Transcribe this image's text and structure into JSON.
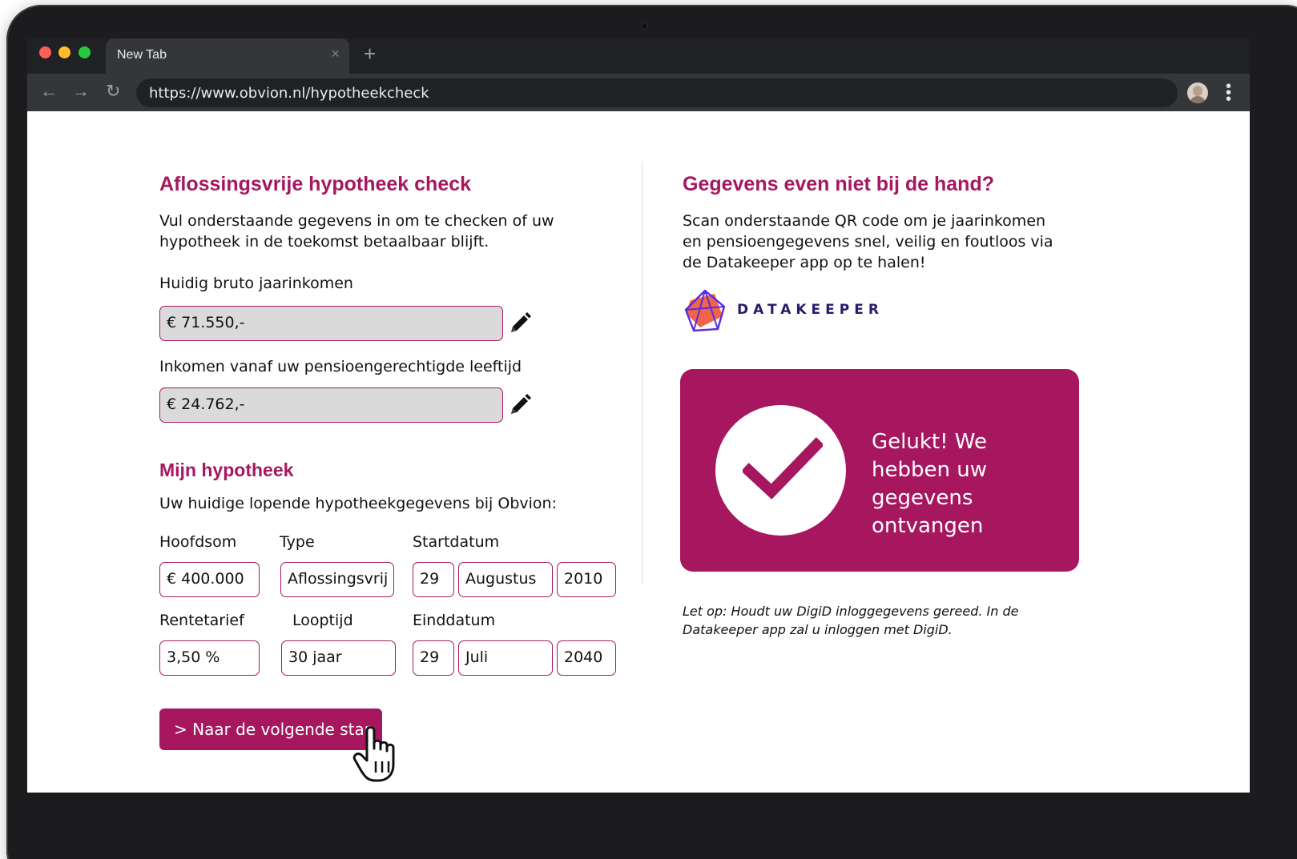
{
  "browser": {
    "tab_title": "New Tab",
    "tab_close": "×",
    "new_tab": "+",
    "url": "https://www.obvion.nl/hypotheekcheck",
    "back": "←",
    "forward": "→",
    "reload": "↻"
  },
  "left": {
    "title": "Aflossingsvrije hypotheek check",
    "intro": "Vul onderstaande gegevens in om te checken of uw hypotheek in de toekomst betaalbaar blijft.",
    "income_label": "Huidig bruto jaarinkomen",
    "income_value": "€  71.550,-",
    "pension_label": "Inkomen vanaf uw pensioengerechtigde leeftijd",
    "pension_value": "€  24.762,-",
    "mortgage_title": "Mijn hypotheek",
    "mortgage_intro": "Uw huidige lopende hypotheekgegevens bij Obvion:",
    "hoofdsom_label": "Hoofdsom",
    "hoofdsom_value": "€  400.000",
    "type_label": "Type",
    "type_value": "Aflossingsvrij",
    "startdatum_label": "Startdatum",
    "start_day": "29",
    "start_month": "Augustus",
    "start_year": "2010",
    "rente_label": "Rentetarief",
    "rente_value": "3,50 %",
    "looptijd_label": "Looptijd",
    "looptijd_value": "30 jaar",
    "einddatum_label": "Einddatum",
    "end_day": "29",
    "end_month": "Juli",
    "end_year": "2040",
    "next_button": "> Naar de volgende stap"
  },
  "right": {
    "title": "Gegevens even niet bij de hand?",
    "intro": "Scan onderstaande QR code om je jaarinkomen en pensioengegevens snel, veilig en foutloos via de Datakeeper app op te halen!",
    "logo_text": "DATAKEEPER",
    "success_text": "Gelukt! We hebben uw gegevens ontvangen",
    "note": "Let op: Houdt uw DigiD inloggegevens gereed. In de Datakeeper app zal u inloggen met DigiD."
  },
  "colors": {
    "brand": "#a6175f",
    "field_fill": "#dadada"
  },
  "icons": [
    "pencil-icon",
    "check-icon",
    "hand-cursor-icon",
    "datakeeper-logo"
  ]
}
